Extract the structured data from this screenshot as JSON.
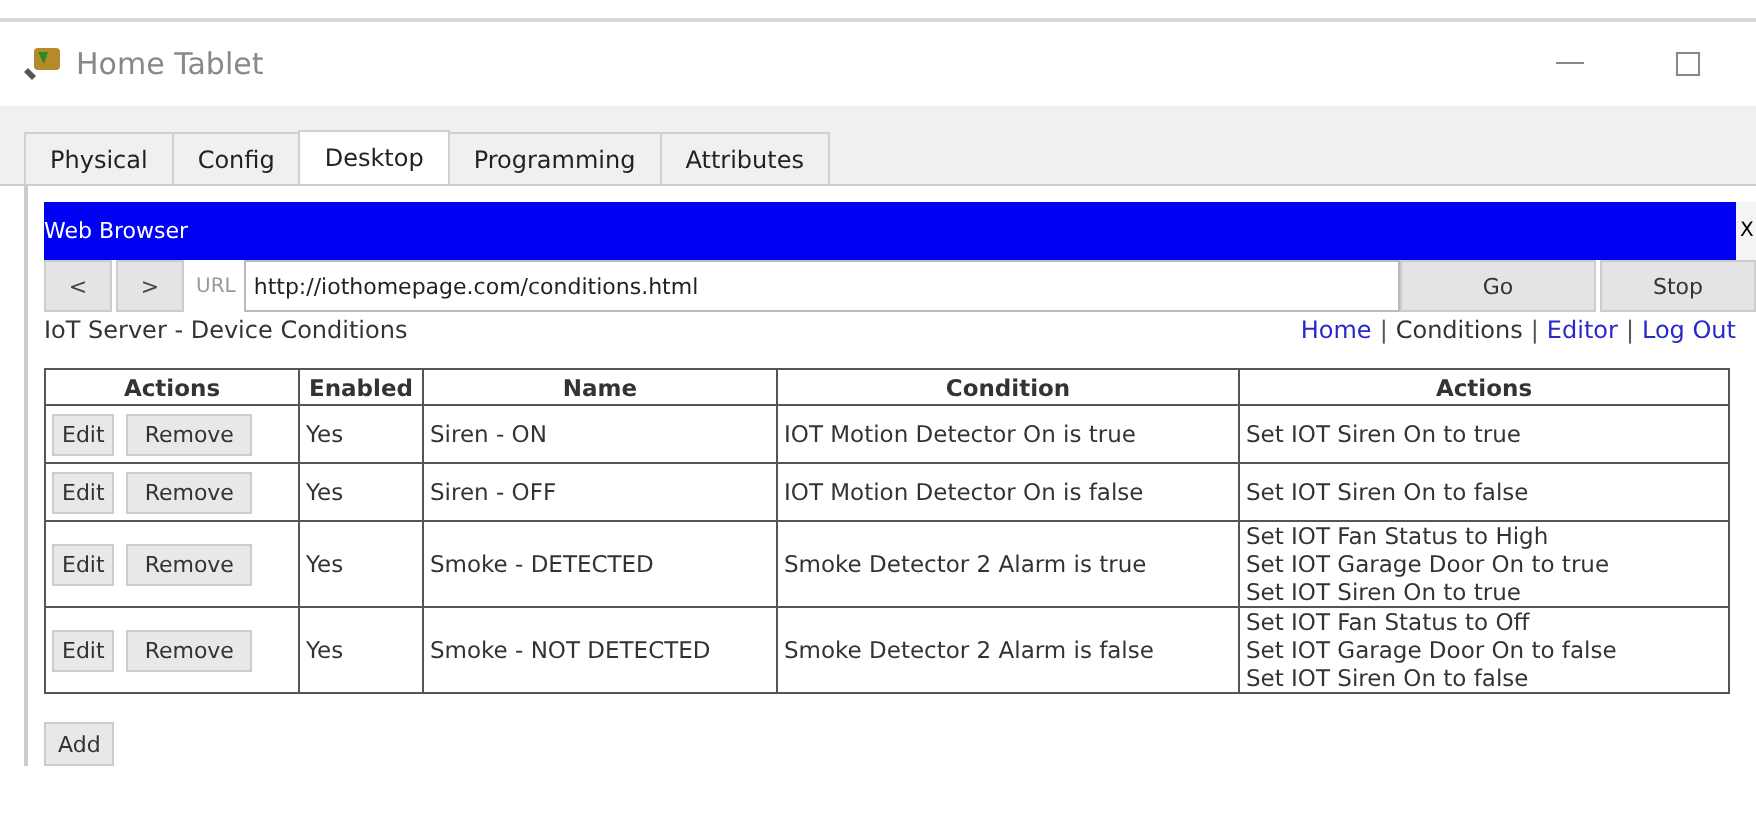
{
  "window": {
    "title": "Home Tablet"
  },
  "tabs": [
    {
      "label": "Physical",
      "selected": false
    },
    {
      "label": "Config",
      "selected": false
    },
    {
      "label": "Desktop",
      "selected": true
    },
    {
      "label": "Programming",
      "selected": false
    },
    {
      "label": "Attributes",
      "selected": false
    }
  ],
  "browser": {
    "title": "Web Browser",
    "close": "X",
    "back": "<",
    "forward": ">",
    "url_label": "URL",
    "url": "http://iothomepage.com/conditions.html",
    "go": "Go",
    "stop": "Stop"
  },
  "page": {
    "heading": "IoT Server - Device Conditions",
    "nav": [
      {
        "label": "Home",
        "selected": false
      },
      {
        "label": "Conditions",
        "selected": true
      },
      {
        "label": "Editor",
        "selected": false
      },
      {
        "label": "Log Out",
        "selected": false
      }
    ],
    "nav_separator": "|",
    "table": {
      "columns": [
        "Actions",
        "Enabled",
        "Name",
        "Condition",
        "Actions"
      ],
      "rows": [
        {
          "edit": "Edit",
          "remove": "Remove",
          "enabled": "Yes",
          "name": "Siren - ON",
          "condition": "IOT Motion Detector On is true",
          "actions": [
            "Set IOT Siren On to true"
          ]
        },
        {
          "edit": "Edit",
          "remove": "Remove",
          "enabled": "Yes",
          "name": "Siren - OFF",
          "condition": "IOT Motion Detector On is false",
          "actions": [
            "Set IOT Siren On to false"
          ]
        },
        {
          "edit": "Edit",
          "remove": "Remove",
          "enabled": "Yes",
          "name": "Smoke - DETECTED",
          "condition": "Smoke Detector 2 Alarm is true",
          "actions": [
            "Set IOT Fan Status to High",
            "Set IOT Garage Door On to true",
            "Set IOT Siren On to true"
          ]
        },
        {
          "edit": "Edit",
          "remove": "Remove",
          "enabled": "Yes",
          "name": "Smoke - NOT DETECTED",
          "condition": "Smoke Detector 2 Alarm is false",
          "actions": [
            "Set IOT Fan Status to Off",
            "Set IOT Garage Door On to false",
            "Set IOT Siren On to false"
          ]
        }
      ]
    },
    "add": "Add"
  }
}
